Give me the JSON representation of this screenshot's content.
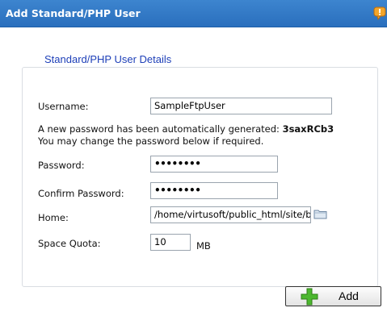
{
  "dialog": {
    "title": "Add Standard/PHP User",
    "group_title": "Standard/PHP User Details"
  },
  "form": {
    "username_label": "Username:",
    "username_value": "SampleFtpUser",
    "notice_line1_prefix": "A new password has been automatically generated:",
    "generated_password": "3saxRCb3",
    "notice_line2": "You may change the password below if required.",
    "password_label": "Password:",
    "password_mask": "••••••••",
    "confirm_label": "Confirm Password:",
    "confirm_mask": "••••••••",
    "home_label": "Home:",
    "home_value": "/home/virtusoft/public_html/site/b",
    "quota_label": "Space Quota:",
    "quota_value": "10",
    "quota_unit": "MB"
  },
  "buttons": {
    "add_label": "Add"
  },
  "icons": {
    "help": "help-icon",
    "browse": "folder-icon",
    "add": "plus-icon"
  },
  "colors": {
    "titlebar": "#2a6fbd",
    "group_title": "#1d3fb8",
    "plus_green": "#4cb82f"
  }
}
